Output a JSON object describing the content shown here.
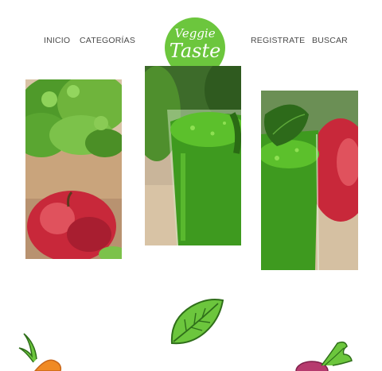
{
  "nav": {
    "inicio": "INICIO",
    "categorias": "CATEGORÍAS",
    "registrate": "REGISTRATE",
    "buscar": "BUSCAR"
  },
  "logo": {
    "line1": "Veggie",
    "line2": "Taste"
  },
  "colors": {
    "brand_green": "#6cc63d",
    "juice_green": "#3e9a1f",
    "apple_red": "#c8283a"
  },
  "gallery": {
    "images": [
      "lettuce-and-apple-photo",
      "green-juice-glass-photo",
      "juice-with-spinach-and-apple-photo"
    ]
  },
  "decorations": [
    "leaf-doodle",
    "carrot-doodle",
    "beet-doodle"
  ]
}
